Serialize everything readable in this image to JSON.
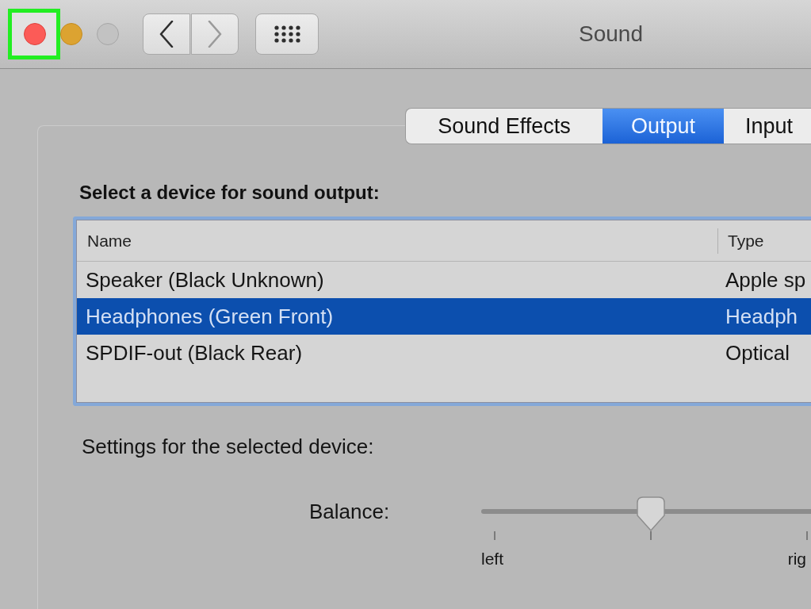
{
  "window": {
    "title": "Sound",
    "controls": [
      {
        "kind": "close",
        "disabled": false,
        "highlighted": true
      },
      {
        "kind": "minimize",
        "disabled": false,
        "highlighted": false
      },
      {
        "kind": "zoom",
        "disabled": true,
        "highlighted": false
      }
    ]
  },
  "toolbar": [
    {
      "kind": "back",
      "disabled": false
    },
    {
      "kind": "forward",
      "disabled": true
    },
    {
      "kind": "show_all",
      "disabled": false
    }
  ],
  "tabs": [
    {
      "label": "Sound Effects",
      "selected": false
    },
    {
      "label": "Output",
      "selected": true
    },
    {
      "label": "Input",
      "selected": false
    }
  ],
  "output": {
    "heading": "Select a device for sound output:",
    "table": {
      "columns": [
        "Name",
        "Type"
      ],
      "rows": [
        {
          "name": "Speaker (Black Unknown)",
          "type": "Apple sp",
          "selected": false
        },
        {
          "name": "Headphones (Green Front)",
          "type": "Headph",
          "selected": true
        },
        {
          "name": "SPDIF-out (Black Rear)",
          "type": "Optical",
          "selected": false
        }
      ]
    }
  },
  "settings": {
    "heading": "Settings for the selected device:",
    "balance": {
      "label": "Balance:",
      "level": 0.5,
      "min_label": "left",
      "max_label": "rig"
    }
  }
}
